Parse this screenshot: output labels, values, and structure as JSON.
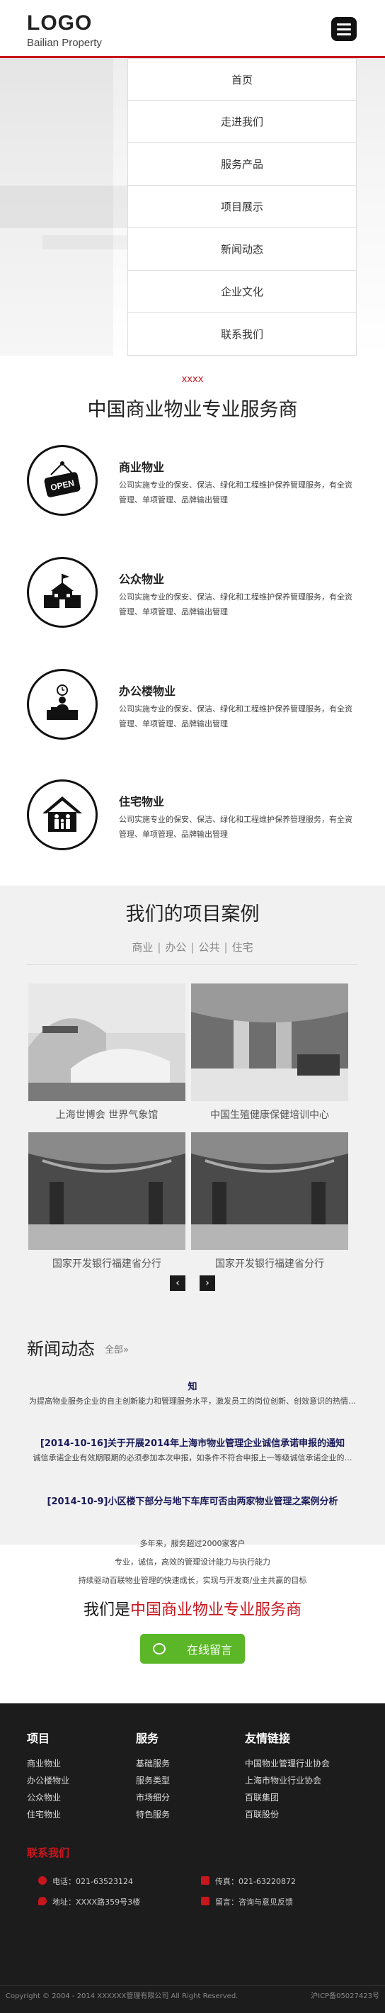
{
  "header": {
    "logo": "LOGO",
    "logo_subtitle": "Bailian Property"
  },
  "nav": {
    "items": [
      "首页",
      "走进我们",
      "服务产品",
      "项目展示",
      "新闻动态",
      "企业文化",
      "联系我们"
    ]
  },
  "services": {
    "tag": "xxxx",
    "title": "中国商业物业专业服务商",
    "items": [
      {
        "title": "商业物业",
        "icon": "open-sign-icon",
        "desc": "公司实施专业的保安、保洁、绿化和工程维护保养管理服务，有全资管理、单项管理、品牌输出管理"
      },
      {
        "title": "公众物业",
        "icon": "school-building-icon",
        "desc": "公司实施专业的保安、保洁、绿化和工程维护保养管理服务，有全资管理、单项管理、品牌输出管理"
      },
      {
        "title": "办公楼物业",
        "icon": "office-desk-icon",
        "desc": "公司实施专业的保安、保洁、绿化和工程维护保养管理服务，有全资管理、单项管理、品牌输出管理"
      },
      {
        "title": "住宅物业",
        "icon": "house-family-icon",
        "desc": "公司实施专业的保安、保洁、绿化和工程维护保养管理服务，有全资管理、单项管理、品牌输出管理"
      }
    ]
  },
  "projects": {
    "title": "我们的项目案例",
    "tabs": [
      "商业",
      "办公",
      "公共",
      "住宅"
    ],
    "cards": [
      {
        "caption": "上海世博会 世界气象馆"
      },
      {
        "caption": "中国生殖健康保健培训中心"
      },
      {
        "caption": "国家开发银行福建省分行"
      },
      {
        "caption": "国家开发银行福建省分行"
      }
    ],
    "prev": "‹",
    "next": "›"
  },
  "news": {
    "title": "新闻动态",
    "more": "全部»",
    "items": [
      {
        "headline": "知",
        "summary": "为提高物业服务企业的自主创新能力和管理服务水平，激发员工的岗位创新、创效意识的热情…"
      },
      {
        "headline": "[2014-10-16]关于开展2014年上海市物业管理企业诚信承诺申报的通知",
        "summary": "诚信承诺企业有效期限期的必须参加本次申报，如条件不符合申报上一等级诚信承诺企业的…"
      },
      {
        "headline": "[2014-10-9]小区楼下部分与地下车库可否由两家物业管理之案例分析",
        "summary": ""
      }
    ]
  },
  "brand": {
    "lines": [
      "多年来，服务超过2000家客户",
      "专业，诚信，高效的管理设计能力与执行能力",
      "持续驱动百联物业管理的快速成长，实现与开发商/业主共赢的目标"
    ],
    "slogan_prefix": "我们是",
    "slogan_red": "中国商业物业专业服务商",
    "button": "在线留言"
  },
  "footer": {
    "columns": [
      {
        "title": "项目",
        "links": [
          "商业物业",
          "办公楼物业",
          "公众物业",
          "住宅物业"
        ]
      },
      {
        "title": "服务",
        "links": [
          "基础服务",
          "服务类型",
          "市场细分",
          "特色服务"
        ]
      },
      {
        "title": "友情链接",
        "links": [
          "中国物业管理行业协会",
          "上海市物业行业协会",
          "百联集团",
          "百联股份"
        ]
      }
    ],
    "contact_title": "联系我们",
    "contacts": [
      {
        "label": "电话：021-63523124",
        "icon": "phone-icon"
      },
      {
        "label": "传真：021-63220872",
        "icon": "fax-icon"
      },
      {
        "label": "地址：XXXX路359号3楼",
        "icon": "location-icon"
      },
      {
        "label": "留言：咨询与意见反馈",
        "icon": "message-icon"
      }
    ],
    "copyright": "Copyright © 2004 - 2014 XXXXXX管理有限公司 All Right Reserved.",
    "icp": "沪ICP备05027423号"
  },
  "colors": {
    "accent": "#c8161d",
    "button": "#5bb727",
    "footer_bg": "#1c1c1c",
    "projects_bg": "#f1f1f1"
  }
}
